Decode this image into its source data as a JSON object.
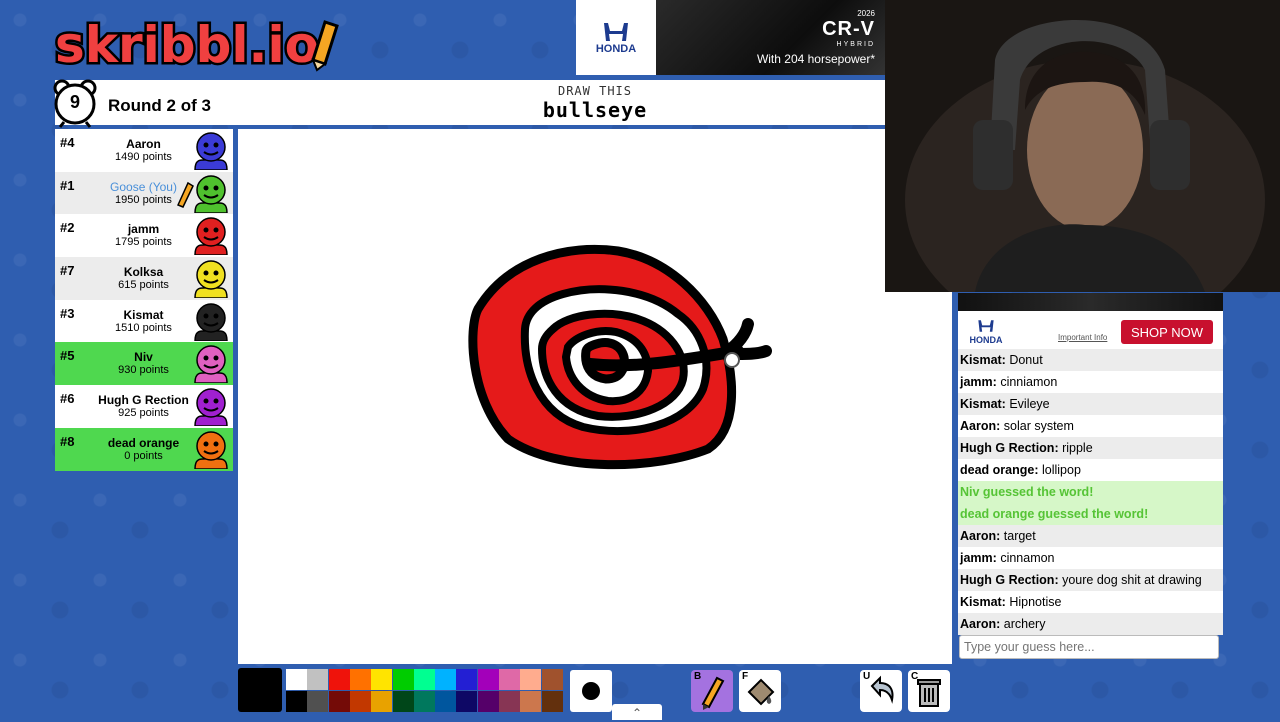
{
  "logo": {
    "text": "skribbl.io"
  },
  "ad_top": {
    "brand": "HONDA",
    "model_year": "2026",
    "model": "CR-V",
    "trim": "HYBRID",
    "tagline": "With 204 horsepower*"
  },
  "header": {
    "timer": "9",
    "round": "Round 2 of 3",
    "draw_label": "DRAW THIS",
    "word": "bullseye"
  },
  "players": [
    {
      "rank": "#4",
      "name": "Aaron",
      "points": "1490 points",
      "color": "#3b3bd6",
      "state": "normal"
    },
    {
      "rank": "#1",
      "name": "Goose (You)",
      "points": "1950 points",
      "color": "#4fc12e",
      "state": "you",
      "drawing": true
    },
    {
      "rank": "#2",
      "name": "jamm",
      "points": "1795 points",
      "color": "#e02020",
      "state": "normal"
    },
    {
      "rank": "#7",
      "name": "Kolksa",
      "points": "615 points",
      "color": "#f0e020",
      "state": "alt"
    },
    {
      "rank": "#3",
      "name": "Kismat",
      "points": "1510 points",
      "color": "#222222",
      "state": "normal"
    },
    {
      "rank": "#5",
      "name": "Niv",
      "points": "930 points",
      "color": "#e060c0",
      "state": "guessed"
    },
    {
      "rank": "#6",
      "name": "Hugh G Rection",
      "points": "925 points",
      "color": "#a020d0",
      "state": "normal"
    },
    {
      "rank": "#8",
      "name": "dead orange",
      "points": "0 points",
      "color": "#f07010",
      "state": "guessed"
    }
  ],
  "ad_side": {
    "brand": "HONDA",
    "important": "Important Info",
    "shop": "SHOP NOW"
  },
  "chat": [
    {
      "who": "Kismat:",
      "text": "Donut",
      "type": "msg"
    },
    {
      "who": "jamm:",
      "text": "cinniamon",
      "type": "msg"
    },
    {
      "who": "Kismat:",
      "text": "Evileye",
      "type": "msg"
    },
    {
      "who": "Aaron:",
      "text": "solar system",
      "type": "msg"
    },
    {
      "who": "Hugh G Rection:",
      "text": "ripple",
      "type": "msg"
    },
    {
      "who": "dead orange:",
      "text": "lollipop",
      "type": "msg"
    },
    {
      "who": "",
      "text": "Niv guessed the word!",
      "type": "good"
    },
    {
      "who": "",
      "text": "dead orange guessed the word!",
      "type": "good"
    },
    {
      "who": "Aaron:",
      "text": "target",
      "type": "msg"
    },
    {
      "who": "jamm:",
      "text": "cinnamon",
      "type": "msg"
    },
    {
      "who": "Hugh G Rection:",
      "text": "youre dog shit at drawing",
      "type": "msg"
    },
    {
      "who": "Kismat:",
      "text": "Hipnotise",
      "type": "msg"
    },
    {
      "who": "Aaron:",
      "text": "archery",
      "type": "msg"
    }
  ],
  "guess": {
    "placeholder": "Type your guess here..."
  },
  "palette": {
    "top": [
      "#ffffff",
      "#c1c1c1",
      "#ef130b",
      "#ff7100",
      "#ffe400",
      "#00cc00",
      "#00ff91",
      "#00b2ff",
      "#231fd3",
      "#a300ba",
      "#df69a7",
      "#ffac8e",
      "#a0522d"
    ],
    "bottom": [
      "#000000",
      "#505050",
      "#740b07",
      "#c23800",
      "#e8a200",
      "#004619",
      "#00785d",
      "#00569e",
      "#0e0865",
      "#550069",
      "#873554",
      "#cc774d",
      "#63300d"
    ],
    "current": "#000000"
  },
  "tools": {
    "pencil_key": "B",
    "fill_key": "F",
    "undo_key": "U",
    "clear_key": "C"
  }
}
